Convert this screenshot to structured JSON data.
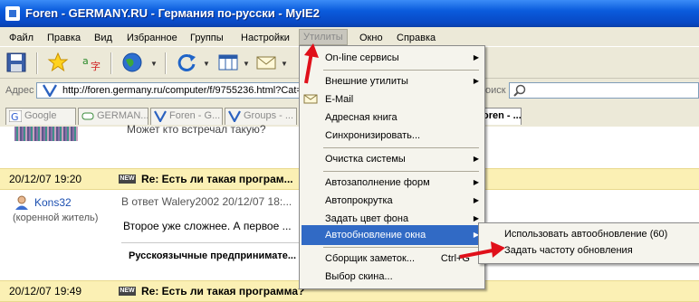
{
  "window": {
    "title": "Foren - GERMANY.RU - Германия по-русски - MyIE2"
  },
  "menubar": [
    "Файл",
    "Правка",
    "Вид",
    "Избранное",
    "Группы",
    "Настройки",
    "Утилиты",
    "Окно",
    "Справка"
  ],
  "address": {
    "label": "Адрес",
    "url": "http://foren.germany.ru/computer/f/9755236.html?Cat="
  },
  "search": {
    "label": "оиск"
  },
  "tabs": [
    "Google",
    "GERMAN...",
    "Foren - G...",
    "Groups - ...",
    "oren - ..."
  ],
  "content": {
    "partial_line": "Может кто встречал такую?",
    "post1": {
      "date": "20/12/07 19:20",
      "new_badge": "NEW",
      "title": "Re: Есть ли такая програм...",
      "author": "Kons32",
      "author_status": "(коренной житель)",
      "reply_info": "В ответ Walery2002 20/12/07 18:...",
      "text": "Второе уже сложнее. А первое ...",
      "signature": "Русскоязычные предпринимате..."
    },
    "post2": {
      "date": "20/12/07 19:49",
      "new_badge": "NEW",
      "title": "Re: Есть ли такая программа?"
    }
  },
  "tools_menu": {
    "items": [
      {
        "label": "On-line сервисы",
        "submenu": true
      },
      {
        "label": "Внешние утилиты",
        "submenu": true
      },
      {
        "label": "E-Mail"
      },
      {
        "label": "Адресная книга"
      },
      {
        "label": "Синхронизировать..."
      },
      {
        "label": "Очистка системы",
        "submenu": true
      },
      {
        "label": "Автозаполнение форм",
        "submenu": true
      },
      {
        "label": "Автопрокрутка",
        "submenu": true
      },
      {
        "label": "Задать цвет фона",
        "submenu": true
      },
      {
        "label": "Автообновление окна",
        "submenu": true,
        "highlighted": true
      },
      {
        "label": "Сборщик заметок...",
        "shortcut": "Ctrl+G"
      },
      {
        "label": "Выбор скина..."
      }
    ]
  },
  "refresh_submenu": {
    "items": [
      "Использовать автообновление (60)",
      "Задать частоту обновления"
    ]
  },
  "colors": {
    "highlight": "#316ac5",
    "annotation_arrow": "#e0101a",
    "post_header": "#fbf0b4",
    "titlebar": "#0a5bdc"
  }
}
